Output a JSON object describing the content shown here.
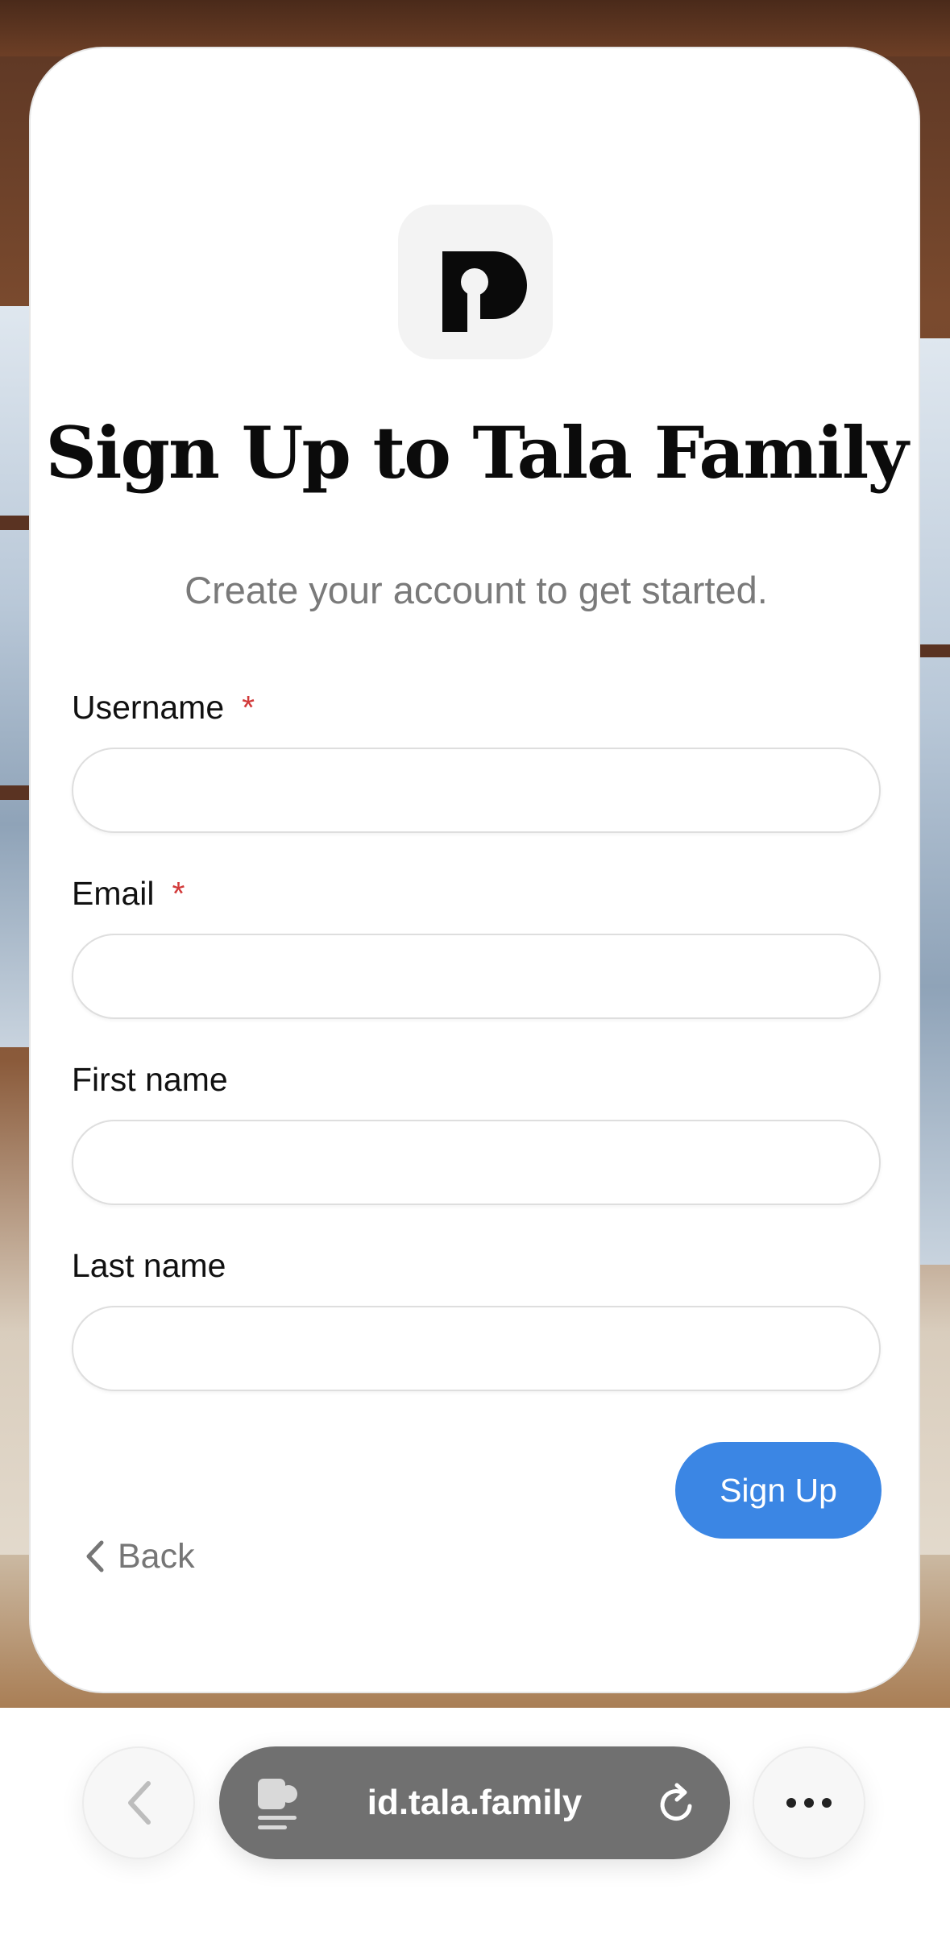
{
  "app": {
    "logo_icon": "tala-p-logo-icon",
    "title": "Sign Up to Tala Family",
    "subtitle": "Create your account to get started."
  },
  "form": {
    "fields": [
      {
        "label": "Username",
        "required": true,
        "required_mark": "*",
        "value": "",
        "placeholder": ""
      },
      {
        "label": "Email",
        "required": true,
        "required_mark": "*",
        "value": "",
        "placeholder": ""
      },
      {
        "label": "First name",
        "required": false,
        "value": "",
        "placeholder": ""
      },
      {
        "label": "Last name",
        "required": false,
        "value": "",
        "placeholder": ""
      }
    ],
    "back_label": "Back",
    "submit_label": "Sign Up"
  },
  "browser": {
    "url": "id.tala.family",
    "icons": {
      "back": "chevron-left-icon",
      "page": "page-menu-icon",
      "reload": "reload-icon",
      "more": "more-icon"
    }
  },
  "colors": {
    "accent": "#3b86e4",
    "required": "#d23a3a",
    "muted_text": "#7a7a7a",
    "url_pill": "#707070"
  }
}
